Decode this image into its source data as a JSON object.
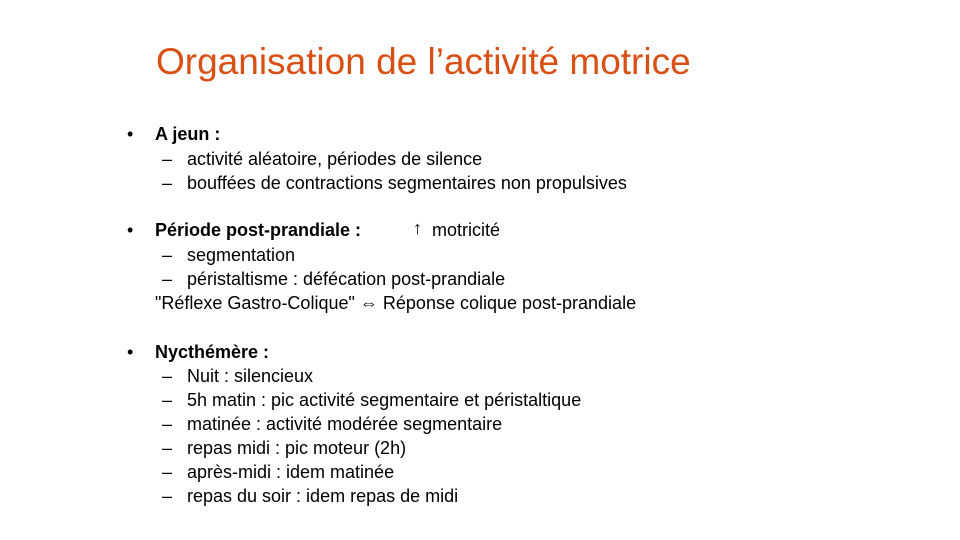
{
  "slide": {
    "title": "Organisation de l’activité motrice",
    "title_color": "#d94f14",
    "sections": [
      {
        "heading": "A jeun :",
        "items": [
          "activité aléatoire, périodes de silence",
          "bouffées de contractions segmentaires non propulsives"
        ]
      },
      {
        "heading": "Période post-prandiale :",
        "heading_note_arrow": "↑",
        "heading_note": "motricité",
        "items": [
          "segmentation",
          "péristaltisme : défécation post-prandiale"
        ],
        "footnote_left": "\"Réflexe Gastro-Colique\"",
        "footnote_arrow": "⇔",
        "footnote_right": "Réponse colique post-prandiale"
      },
      {
        "heading": "Nycthémère :",
        "items": [
          "Nuit : silencieux",
          "5h matin : pic activité segmentaire et péristaltique",
          "matinée : activité modérée segmentaire",
          "repas midi : pic moteur (2h)",
          "après-midi : idem matinée",
          "repas du soir : idem repas de midi"
        ]
      }
    ],
    "bullet_char": "•",
    "dash_char": "–"
  }
}
